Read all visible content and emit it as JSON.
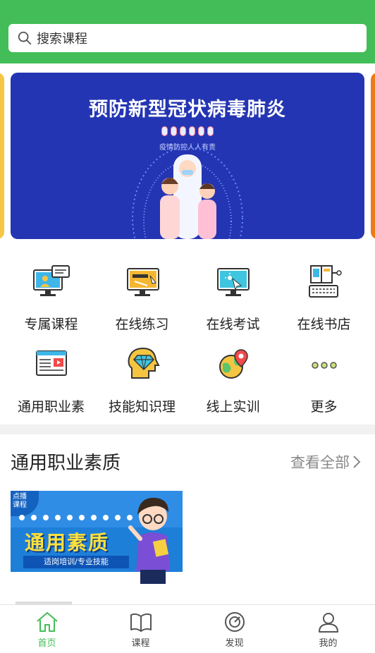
{
  "search": {
    "placeholder": "搜索课程",
    "icon": "search-icon"
  },
  "banner": {
    "title": "预防新型冠状病毒肺炎",
    "subtitle": "疫情防控人人有责"
  },
  "menu": {
    "items": [
      {
        "label": "专属课程",
        "icon": "monitor-user-icon"
      },
      {
        "label": "在线练习",
        "icon": "monitor-ruler-icon"
      },
      {
        "label": "在线考试",
        "icon": "monitor-cursor-icon"
      },
      {
        "label": "在线书店",
        "icon": "book-keyboard-icon"
      },
      {
        "label": "通用职业素",
        "icon": "document-video-icon"
      },
      {
        "label": "技能知识理",
        "icon": "head-diamond-icon"
      },
      {
        "label": "线上实训",
        "icon": "globe-pin-icon"
      },
      {
        "label": "更多",
        "icon": "more-dots-icon"
      }
    ]
  },
  "section": {
    "title": "通用职业素质",
    "view_all": "查看全部"
  },
  "course": {
    "corner_tag": "点播\n课程",
    "title": "通用素质",
    "subtitle": "适岗培训/专业技能"
  },
  "tabbar": {
    "tabs": [
      {
        "label": "首页",
        "icon": "home-icon",
        "active": true
      },
      {
        "label": "课程",
        "icon": "book-icon",
        "active": false
      },
      {
        "label": "发现",
        "icon": "compass-icon",
        "active": false
      },
      {
        "label": "我的",
        "icon": "user-icon",
        "active": false
      }
    ],
    "active_color": "#43bd57"
  },
  "colors": {
    "brand_green": "#43bd57",
    "banner_blue": "#2435b3"
  }
}
